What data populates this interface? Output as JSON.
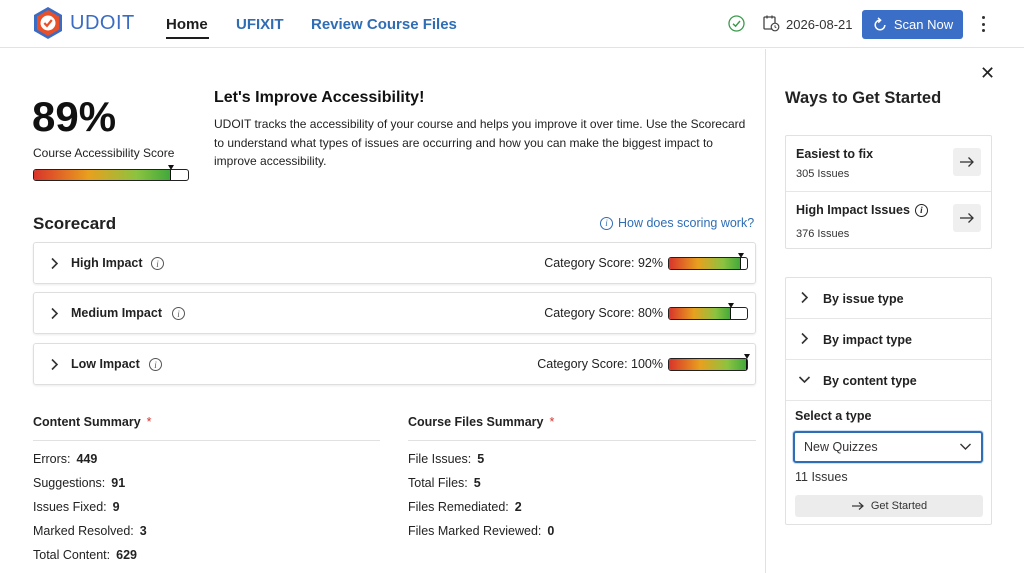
{
  "header": {
    "app_name": "UDOIT",
    "nav": [
      {
        "label": "Home",
        "active": true
      },
      {
        "label": "UFIXIT",
        "active": false
      },
      {
        "label": "Review Course Files",
        "active": false
      }
    ],
    "date": "2026-08-21",
    "scan_button": "Scan Now",
    "status_icon": "check-circle-icon",
    "brand_color": "#3b6fc7"
  },
  "overview": {
    "score_percent": "89%",
    "score_label": "Course Accessibility Score",
    "score_value": 89,
    "intro_title": "Let's Improve Accessibility!",
    "intro_body": "UDOIT tracks the accessibility of your course and helps you improve it over time. Use the Scorecard to understand what types of issues are occurring and how you can make the biggest impact to improve accessibility."
  },
  "scorecard": {
    "title": "Scorecard",
    "help_link": "How does scoring work?",
    "categories": [
      {
        "name": "High Impact",
        "score_text": "Category Score: 92%",
        "score": 92
      },
      {
        "name": "Medium Impact",
        "score_text": "Category Score: 80%",
        "score": 80
      },
      {
        "name": "Low Impact",
        "score_text": "Category Score: 100%",
        "score": 100
      }
    ]
  },
  "content_summary": {
    "title": "Content Summary",
    "required_mark": "*",
    "rows": [
      {
        "label": "Errors:",
        "value": "449"
      },
      {
        "label": "Suggestions:",
        "value": "91"
      },
      {
        "label": "Issues Fixed:",
        "value": "9"
      },
      {
        "label": "Marked Resolved:",
        "value": "3"
      },
      {
        "label": "Total Content:",
        "value": "629"
      }
    ]
  },
  "files_summary": {
    "title": "Course Files Summary",
    "required_mark": "*",
    "rows": [
      {
        "label": "File Issues:",
        "value": "5"
      },
      {
        "label": "Total Files:",
        "value": "5"
      },
      {
        "label": "Files Remediated:",
        "value": "2"
      },
      {
        "label": "Files Marked Reviewed:",
        "value": "0"
      }
    ]
  },
  "sidebar": {
    "title": "Ways to Get Started",
    "quick": [
      {
        "title": "Easiest to fix",
        "count": "305 Issues"
      },
      {
        "title": "High Impact Issues",
        "count": "376 Issues"
      }
    ],
    "filters": [
      {
        "label": "By issue type",
        "expanded": false
      },
      {
        "label": "By impact type",
        "expanded": false
      },
      {
        "label": "By content type",
        "expanded": true
      }
    ],
    "select_label": "Select a type",
    "selected_type": "New Quizzes",
    "type_count": "11 Issues",
    "get_started": "Get Started"
  }
}
